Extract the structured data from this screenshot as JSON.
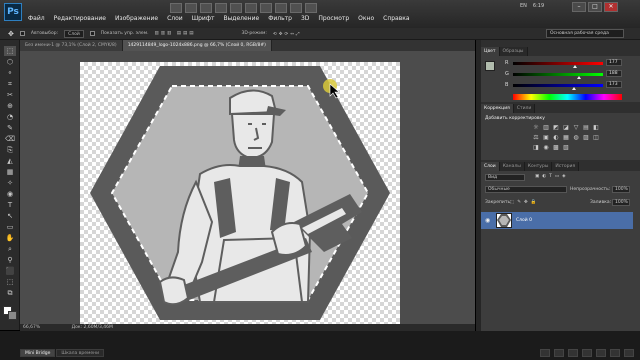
{
  "app": {
    "logo": "Ps",
    "menu": [
      "Файл",
      "Редактирование",
      "Изображение",
      "Слои",
      "Шрифт",
      "Выделение",
      "Фильтр",
      "3D",
      "Просмотр",
      "Окно",
      "Справка"
    ],
    "tray": {
      "lang": "EN",
      "time": "6:19"
    },
    "window_controls": [
      "–",
      "□",
      "✕"
    ]
  },
  "options_bar": {
    "tool_icon": "brush-tool-icon",
    "autoselect_label": "Автовыбор:",
    "autoselect_value": "Слой",
    "transform_label": "Показать упр. элем.",
    "mode_label": "3D-режим:",
    "workspace": "Основная рабочая среда"
  },
  "doc_tabs": [
    {
      "label": "Без имени-1 @ 73,1% (Слой 2, CMYK/8)",
      "active": false
    },
    {
      "label": "1429114849_logo-1024x886.png @ 66,7% (Слой 0, RGB/8#)",
      "active": true
    }
  ],
  "status": {
    "zoom": "66,67%",
    "doc": "Док: 2,60M/3,46M"
  },
  "bottom_tabs": [
    {
      "label": "Mini Bridge",
      "active": true
    },
    {
      "label": "Шкала времени",
      "active": false
    }
  ],
  "color_panel": {
    "tabs": [
      {
        "label": "Цвет",
        "active": true
      },
      {
        "label": "Образцы",
        "active": false
      }
    ],
    "channels": [
      {
        "label": "R",
        "value": "177",
        "colors": [
          "#000000",
          "#ff0000"
        ],
        "pos": 0.694
      },
      {
        "label": "G",
        "value": "188",
        "colors": [
          "#000000",
          "#00ff00"
        ],
        "pos": 0.737
      },
      {
        "label": "B",
        "value": "173",
        "colors": [
          "#000000",
          "#0000ff"
        ],
        "pos": 0.678
      }
    ],
    "foreground": "#b1bcad",
    "background": "#ffffff"
  },
  "adjust_panel": {
    "tabs": [
      {
        "label": "Коррекция",
        "active": true
      },
      {
        "label": "Стили",
        "active": false
      }
    ],
    "heading": "Добавить корректировку",
    "icons": [
      "☼",
      "▥",
      "◩",
      "◪",
      "▽",
      "▤",
      "◧",
      "⚖",
      "▣",
      "◐",
      "▦",
      "◍",
      "▨",
      "◫",
      "◨",
      "◉",
      "▩",
      "▧"
    ]
  },
  "layers_panel": {
    "tabs": [
      {
        "label": "Слои",
        "active": true
      },
      {
        "label": "Каналы",
        "active": false
      },
      {
        "label": "Контуры",
        "active": false
      },
      {
        "label": "История",
        "active": false
      }
    ],
    "kind": "Вид",
    "blend": "Обычные",
    "opacity_label": "Непрозрачность:",
    "opacity": "100%",
    "lock_label": "Закрепить:",
    "fill_label": "Заливка:",
    "fill": "100%",
    "layers": [
      {
        "name": "Слой 0",
        "selected": true,
        "visible": true
      }
    ]
  },
  "tools": [
    "⬚",
    "⬡",
    "⚬",
    "⌗",
    "✂",
    "⊕",
    "◔",
    "✎",
    "⌫",
    "⎘",
    "◭",
    "▦",
    "✧",
    "◉",
    "T",
    "↖",
    "▭",
    "✋",
    "⌕",
    "⚲",
    "⬛",
    "⬚",
    "⧉"
  ],
  "colors": {
    "hex_outer": "#5a5a5a",
    "hex_inner": "#b6b6b6",
    "dash": "#ffffff",
    "figure_light": "#e8e8e8",
    "figure_dark": "#5e5e5e",
    "cursor": "#d8c83a"
  }
}
